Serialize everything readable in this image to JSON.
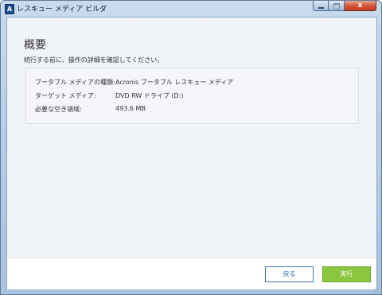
{
  "window": {
    "title": "レスキュー メディア ビルダ",
    "app_icon_glyph": "A",
    "close_glyph": "x"
  },
  "page": {
    "title": "概要",
    "subtitle": "続行する前に、操作の詳細を確認してください。"
  },
  "summary": [
    {
      "label": "ブータブル メディアの種類:",
      "value": "Acronis ブータブル レスキュー メディア"
    },
    {
      "label": "ターゲット メディア:",
      "value": "DVD RW ドライブ (D:)"
    },
    {
      "label": "必要な空き領域:",
      "value": "493.6 MB"
    }
  ],
  "buttons": {
    "back": "戻る",
    "run": "実行"
  },
  "colors": {
    "accent_blue": "#2a64b3",
    "run_green": "#8cc63f",
    "content_background": "#f0f3f8"
  }
}
